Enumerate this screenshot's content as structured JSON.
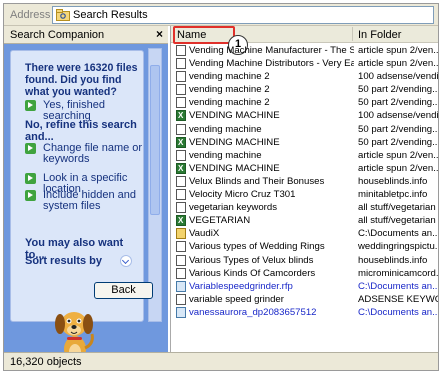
{
  "address": {
    "label": "Address",
    "value": "Search Results"
  },
  "companion": {
    "title": "Search Companion",
    "result_message": "There were 16320 files found. Did you find what you wanted?",
    "finished_link": "Yes, finished searching",
    "refine_heading": "No, refine this search and...",
    "refine_links": [
      "Change file name or keywords",
      "Look in a specific location",
      "Include hidden and system files"
    ],
    "also_heading": "You may also want to...",
    "sort_label": "Sort results by",
    "back_button": "Back"
  },
  "list": {
    "columns": {
      "name": "Name",
      "folder": "In Folder"
    },
    "annotation_number": "1",
    "rows": [
      {
        "name": "Vending Machine Manufacturer - The So...",
        "folder": "article spun 2/ven...",
        "icon": "file"
      },
      {
        "name": "Vending Machine Distributors - Very Eas...",
        "folder": "article spun 2/ven...",
        "icon": "file"
      },
      {
        "name": "vending machine 2",
        "folder": "100 adsense/vendi...",
        "icon": "file"
      },
      {
        "name": "vending machine 2",
        "folder": "50 part 2/vending...",
        "icon": "file"
      },
      {
        "name": "vending machine 2",
        "folder": "50 part 2/vending...",
        "icon": "file"
      },
      {
        "name": "VENDING MACHINE",
        "folder": "100 adsense/vendi...",
        "icon": "xls"
      },
      {
        "name": "vending machine",
        "folder": "50 part 2/vending...",
        "icon": "file"
      },
      {
        "name": "VENDING MACHINE",
        "folder": "50 part 2/vending...",
        "icon": "xls"
      },
      {
        "name": "vending machine",
        "folder": "article spun 2/ven...",
        "icon": "file"
      },
      {
        "name": "VENDING MACHINE",
        "folder": "article spun 2/ven...",
        "icon": "xls"
      },
      {
        "name": "Velux Blinds and Their Bonuses",
        "folder": "houseblinds.info",
        "icon": "file"
      },
      {
        "name": "Velocity Micro Cruz T301",
        "folder": "minitabletpc.info",
        "icon": "file"
      },
      {
        "name": "vegetarian keywords",
        "folder": "all stuff/vegetarian",
        "icon": "file"
      },
      {
        "name": "VEGETARIAN",
        "folder": "all stuff/vegetarian",
        "icon": "xls"
      },
      {
        "name": "VaudiX",
        "folder": "C:\\Documents an...",
        "icon": "vdx"
      },
      {
        "name": "Various types of Wedding Rings",
        "folder": "weddingringspictu...",
        "icon": "file"
      },
      {
        "name": "Various Types of Velux blinds",
        "folder": "houseblinds.info",
        "icon": "file"
      },
      {
        "name": "Various Kinds Of Camcorders",
        "folder": "microminicamcord...",
        "icon": "file"
      },
      {
        "name": "Variablespeedgrinder.rfp",
        "folder": "C:\\Documents an...",
        "icon": "img",
        "blue": true
      },
      {
        "name": "variable speed grinder",
        "folder": "ADSENSE KEYWO...",
        "icon": "file"
      },
      {
        "name": "vanessaurora_dp2083657512",
        "folder": "C:\\Documents an...",
        "icon": "img",
        "blue": true
      }
    ]
  },
  "status": {
    "text": "16,320 objects"
  }
}
